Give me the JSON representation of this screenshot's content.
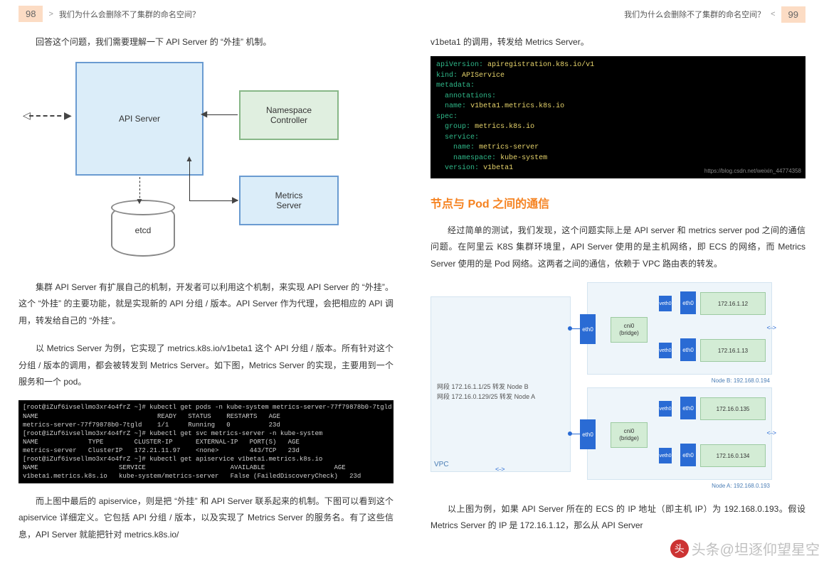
{
  "header": {
    "left_page_num": "98",
    "right_page_num": "99",
    "breadcrumb": "我们为什么会删除不了集群的命名空间？"
  },
  "left": {
    "p1_intro": "回答这个问题，我们需要理解一下 API Server 的 “外挂” 机制。",
    "diag": {
      "api": "API Server",
      "nsc": "Namespace\nController",
      "ms": "Metrics\nServer",
      "etcd": "etcd"
    },
    "p2": "集群 API Server 有扩展自己的机制，开发者可以利用这个机制，来实现 API Server 的 “外挂”。这个 “外挂” 的主要功能，就是实现新的 API 分组 / 版本。API Server 作为代理，会把相应的 API 调用，转发给自己的 “外挂”。",
    "p3": "以 Metrics Server 为例，它实现了 metrics.k8s.io/v1beta1 这个 API 分组 / 版本。所有针对这个分组 / 版本的调用，都会被转发到 Metrics Server。如下图，Metrics Server 的实现，主要用到一个服务和一个 pod。",
    "terminal": "[root@iZuf6ivsellmo3xr4o4frZ ~]# kubectl get pods -n kube-system metrics-server-77f79878b0-7tgld\nNAME                               READY   STATUS    RESTARTS   AGE\nmetrics-server-77f79878b0-7tgld    1/1     Running   0          23d\n[root@iZuf6ivsellmo3xr4o4frZ ~]# kubectl get svc metrics-server -n kube-system\nNAME             TYPE        CLUSTER-IP      EXTERNAL-IP   PORT(S)   AGE\nmetrics-server   ClusterIP   172.21.11.97    <none>        443/TCP   23d\n[root@iZuf6ivsellmo3xr4o4frZ ~]# kubectl get apiservice v1beta1.metrics.k8s.io\nNAME                     SERVICE                      AVAILABLE                  AGE\nv1beta1.metrics.k8s.io   kube-system/metrics-server   False (FailedDiscoveryCheck)   23d",
    "p4": "而上图中最后的 apiservice，则是把 “外挂” 和 API Server 联系起来的机制。下图可以看到这个 apiservice 详细定义。它包括 API 分组 / 版本，以及实现了 Metrics Server 的服务名。有了这些信息，API Server 就能把针对 metrics.k8s.io/"
  },
  "right": {
    "cont": "v1beta1 的调用，转发给 Metrics Server。",
    "yaml": {
      "apiVersion_k": "apiVersion",
      "apiVersion_v": "apiregistration.k8s.io/v1",
      "kind_k": "kind",
      "kind_v": "APIService",
      "metadata_k": "metadata",
      "annotations_k": "annotations",
      "name_k": "name",
      "name_v": "v1beta1.metrics.k8s.io",
      "spec_k": "spec",
      "group_k": "group",
      "group_v": "metrics.k8s.io",
      "service_k": "service",
      "svc_name_k": "name",
      "svc_name_v": "metrics-server",
      "ns_k": "namespace",
      "ns_v": "kube-system",
      "ver_k": "version",
      "ver_v": "v1beta1",
      "watermark": "https://blog.csdn.net/weixin_44774358"
    },
    "h2": "节点与 Pod 之间的通信",
    "p_net": "经过简单的测试，我们发现，这个问题实际上是 API server 和 metrics server pod 之间的通信问题。在阿里云 K8S 集群环境里，API Server 使用的是主机网络，即 ECS 的网络，而 Metrics Server 使用的是 Pod 网络。这两者之间的通信，依赖于 VPC 路由表的转发。",
    "net": {
      "vpc": "VPC",
      "route1": "网段 172.16.1.1/25 转发 Node B",
      "route2": "网段 172.16.0.129/25 转发 Node A",
      "eth0": "eth0",
      "cni": "cni0\n(bridge)",
      "veth": "veth0",
      "nodeB_cap": "Node B: 192.168.0.194",
      "nodeA_cap": "Node A: 192.168.0.193",
      "pod_b1": "172.16.1.12",
      "pod_b2": "172.16.1.13",
      "pod_a1": "172.16.0.135",
      "pod_a2": "172.16.0.134"
    },
    "p_end": "以上图为例，如果 API Server 所在的 ECS 的 IP 地址（即主机 IP）为 192.168.0.193。假设 Metrics Server 的 IP 是 172.16.1.12，那么从 API Server",
    "watermark": "头条@坦逐仰望星空"
  }
}
